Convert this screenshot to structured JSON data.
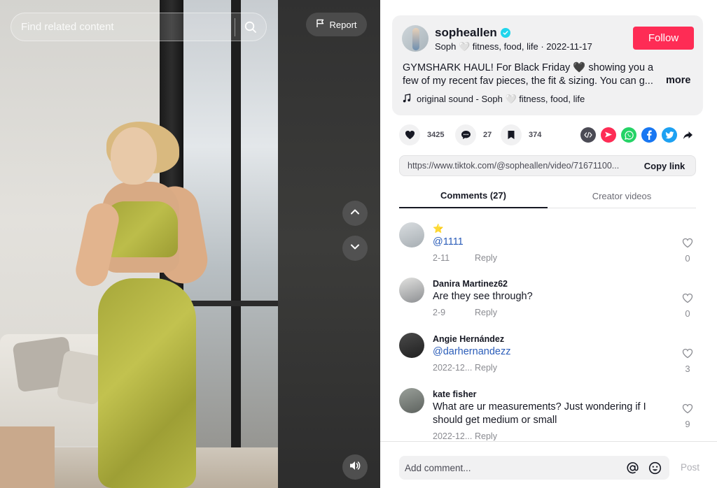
{
  "video": {
    "search_placeholder": "Find related content",
    "report_label": "Report"
  },
  "post": {
    "username": "sopheallen",
    "subline": "Soph 🤍 fitness, food, life · 2022-11-17",
    "follow_label": "Follow",
    "caption": "GYMSHARK HAUL! For Black Friday 🖤 showing you a few of my recent fav pieces, the fit & sizing. You can g...",
    "more_label": "more",
    "sound": "original sound - Soph 🤍 fitness, food, life"
  },
  "actions": {
    "likes": "3425",
    "comments": "27",
    "saves": "374"
  },
  "share_icons": [
    "embed-icon",
    "send-icon",
    "whatsapp-icon",
    "facebook-icon",
    "twitter-icon",
    "share-arrow-icon"
  ],
  "colors": {
    "accent": "#fe2c55",
    "embed": "#4b4b55",
    "send": "#fe2c55",
    "whatsapp": "#25d366",
    "facebook": "#1877f2",
    "twitter": "#1da1f2",
    "mention": "#2b5db9",
    "verified": "#20d5ec"
  },
  "link": {
    "url": "https://www.tiktok.com/@sopheallen/video/71671100...",
    "copy_label": "Copy link"
  },
  "tabs": {
    "comments": "Comments (27)",
    "creator_videos": "Creator videos"
  },
  "comments": [
    {
      "name": "⭐",
      "text": "@1111",
      "date": "2-11",
      "reply": "Reply",
      "likes": "0"
    },
    {
      "name": "Danira Martinez62",
      "text": "Are they see through?",
      "date": "2-9",
      "reply": "Reply",
      "likes": "0"
    },
    {
      "name": "Angie Hernández",
      "text": "@darhernandezz",
      "date": "2022-12...",
      "reply": "Reply",
      "likes": "3"
    },
    {
      "name": "kate fisher",
      "text": "What are ur measurements? Just wondering if I should get medium or small",
      "date": "2022-12...",
      "reply": "Reply",
      "likes": "9"
    }
  ],
  "comment_bar": {
    "placeholder": "Add comment...",
    "post_label": "Post"
  }
}
